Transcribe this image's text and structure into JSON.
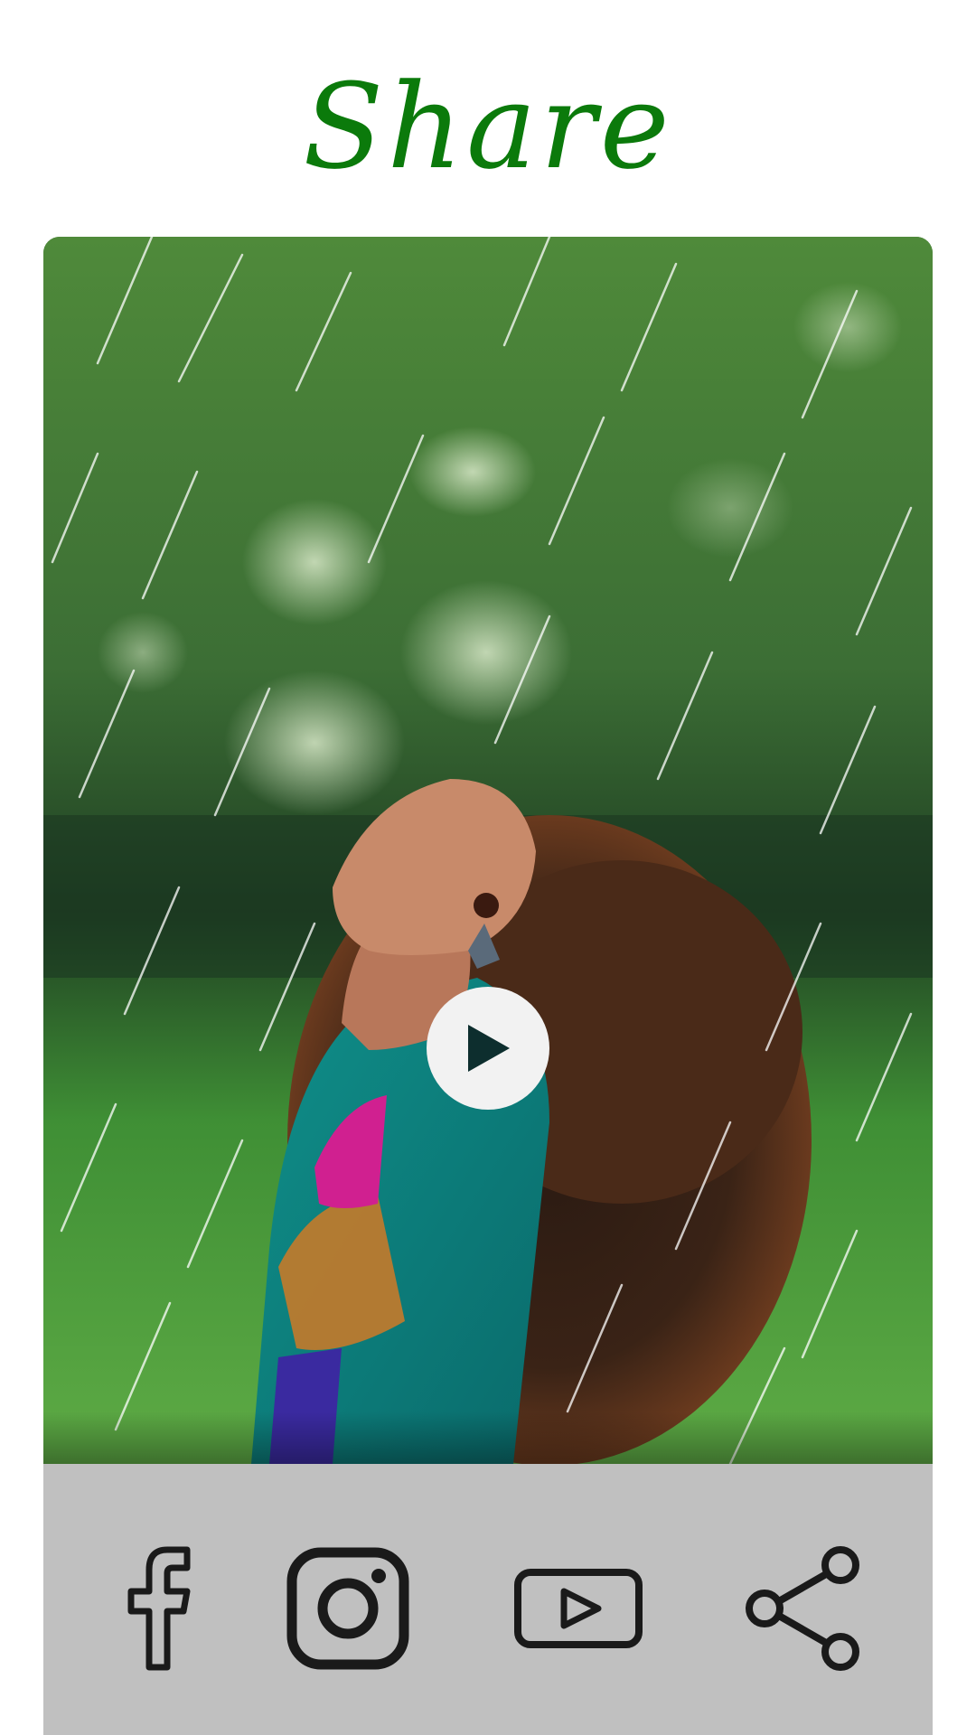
{
  "header": {
    "title": "Share",
    "title_color": "#0b7a0b"
  },
  "preview": {
    "image_description_icon": "photo-preview",
    "play_icon": "play-icon",
    "play_button_color": "#f2f2f2",
    "play_icon_color": "#0d2e2e"
  },
  "share_bar": {
    "background": "#c0c0c0",
    "icon_color": "#1a1a1a",
    "buttons": [
      {
        "icon": "facebook-icon"
      },
      {
        "icon": "instagram-icon"
      },
      {
        "icon": "youtube-icon"
      },
      {
        "icon": "share-icon"
      }
    ]
  }
}
